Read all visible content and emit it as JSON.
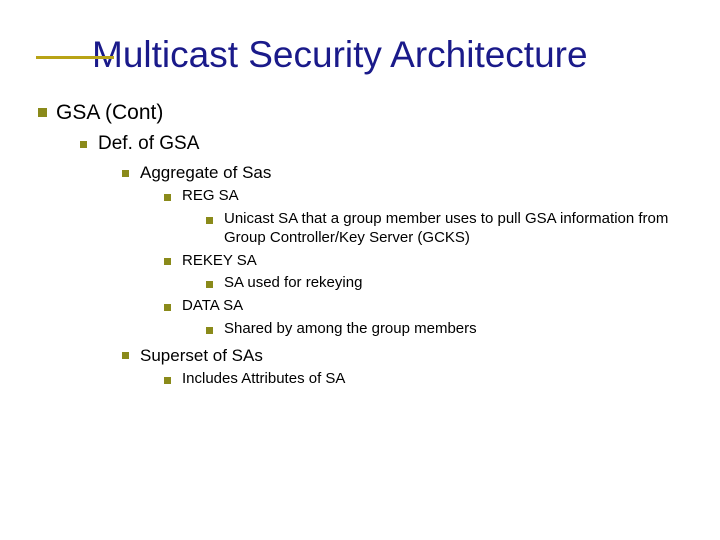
{
  "title": "Multicast Security Architecture",
  "lvl1": {
    "a": "GSA (Cont)"
  },
  "lvl2": {
    "a": "Def. of GSA"
  },
  "lvl3": {
    "a": "Aggregate of Sas",
    "b": "Superset of SAs"
  },
  "lvl4": {
    "a": "REG SA",
    "b": "REKEY SA",
    "c": "DATA SA",
    "d": "Includes Attributes of SA"
  },
  "lvl5": {
    "a": "Unicast SA that a group member uses to pull GSA information from Group Controller/Key Server (GCKS)",
    "b": "SA used for rekeying",
    "c": "Shared by among the group members"
  }
}
